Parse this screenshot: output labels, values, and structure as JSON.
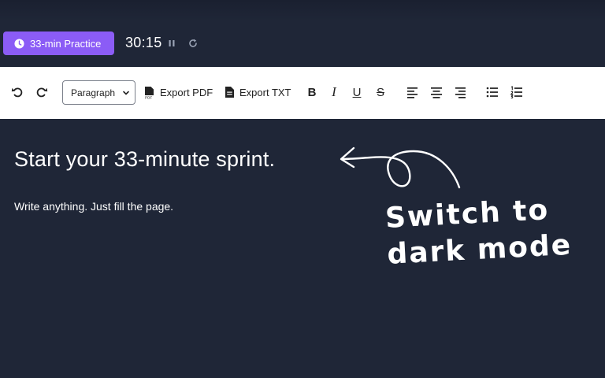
{
  "timer_bar": {
    "mode_label": "33-min Practice",
    "time_remaining": "30:15",
    "icons": {
      "mode": "clock-icon",
      "pause": "pause-icon",
      "reset": "reset-icon"
    }
  },
  "toolbar": {
    "undo_icon": "undo-icon",
    "redo_icon": "redo-icon",
    "block_format_value": "Paragraph",
    "export_pdf_label": "Export PDF",
    "export_txt_label": "Export TXT",
    "format_icons": [
      "bold-icon",
      "italic-icon",
      "underline-icon",
      "strikethrough-icon"
    ],
    "align_icons": [
      "align-left-icon",
      "align-center-icon",
      "align-right-icon"
    ],
    "list_icons": [
      "bullet-list-icon",
      "numbered-list-icon"
    ]
  },
  "editor": {
    "title": "Start your 33-minute sprint.",
    "body": "Write anything. Just fill the page."
  },
  "annotation": {
    "line1": "Switch to",
    "line2": "dark mode"
  },
  "colors": {
    "background": "#1f2637",
    "accent": "#8b5cf6",
    "toolbar": "#ffffff",
    "text": "#ffffff"
  }
}
